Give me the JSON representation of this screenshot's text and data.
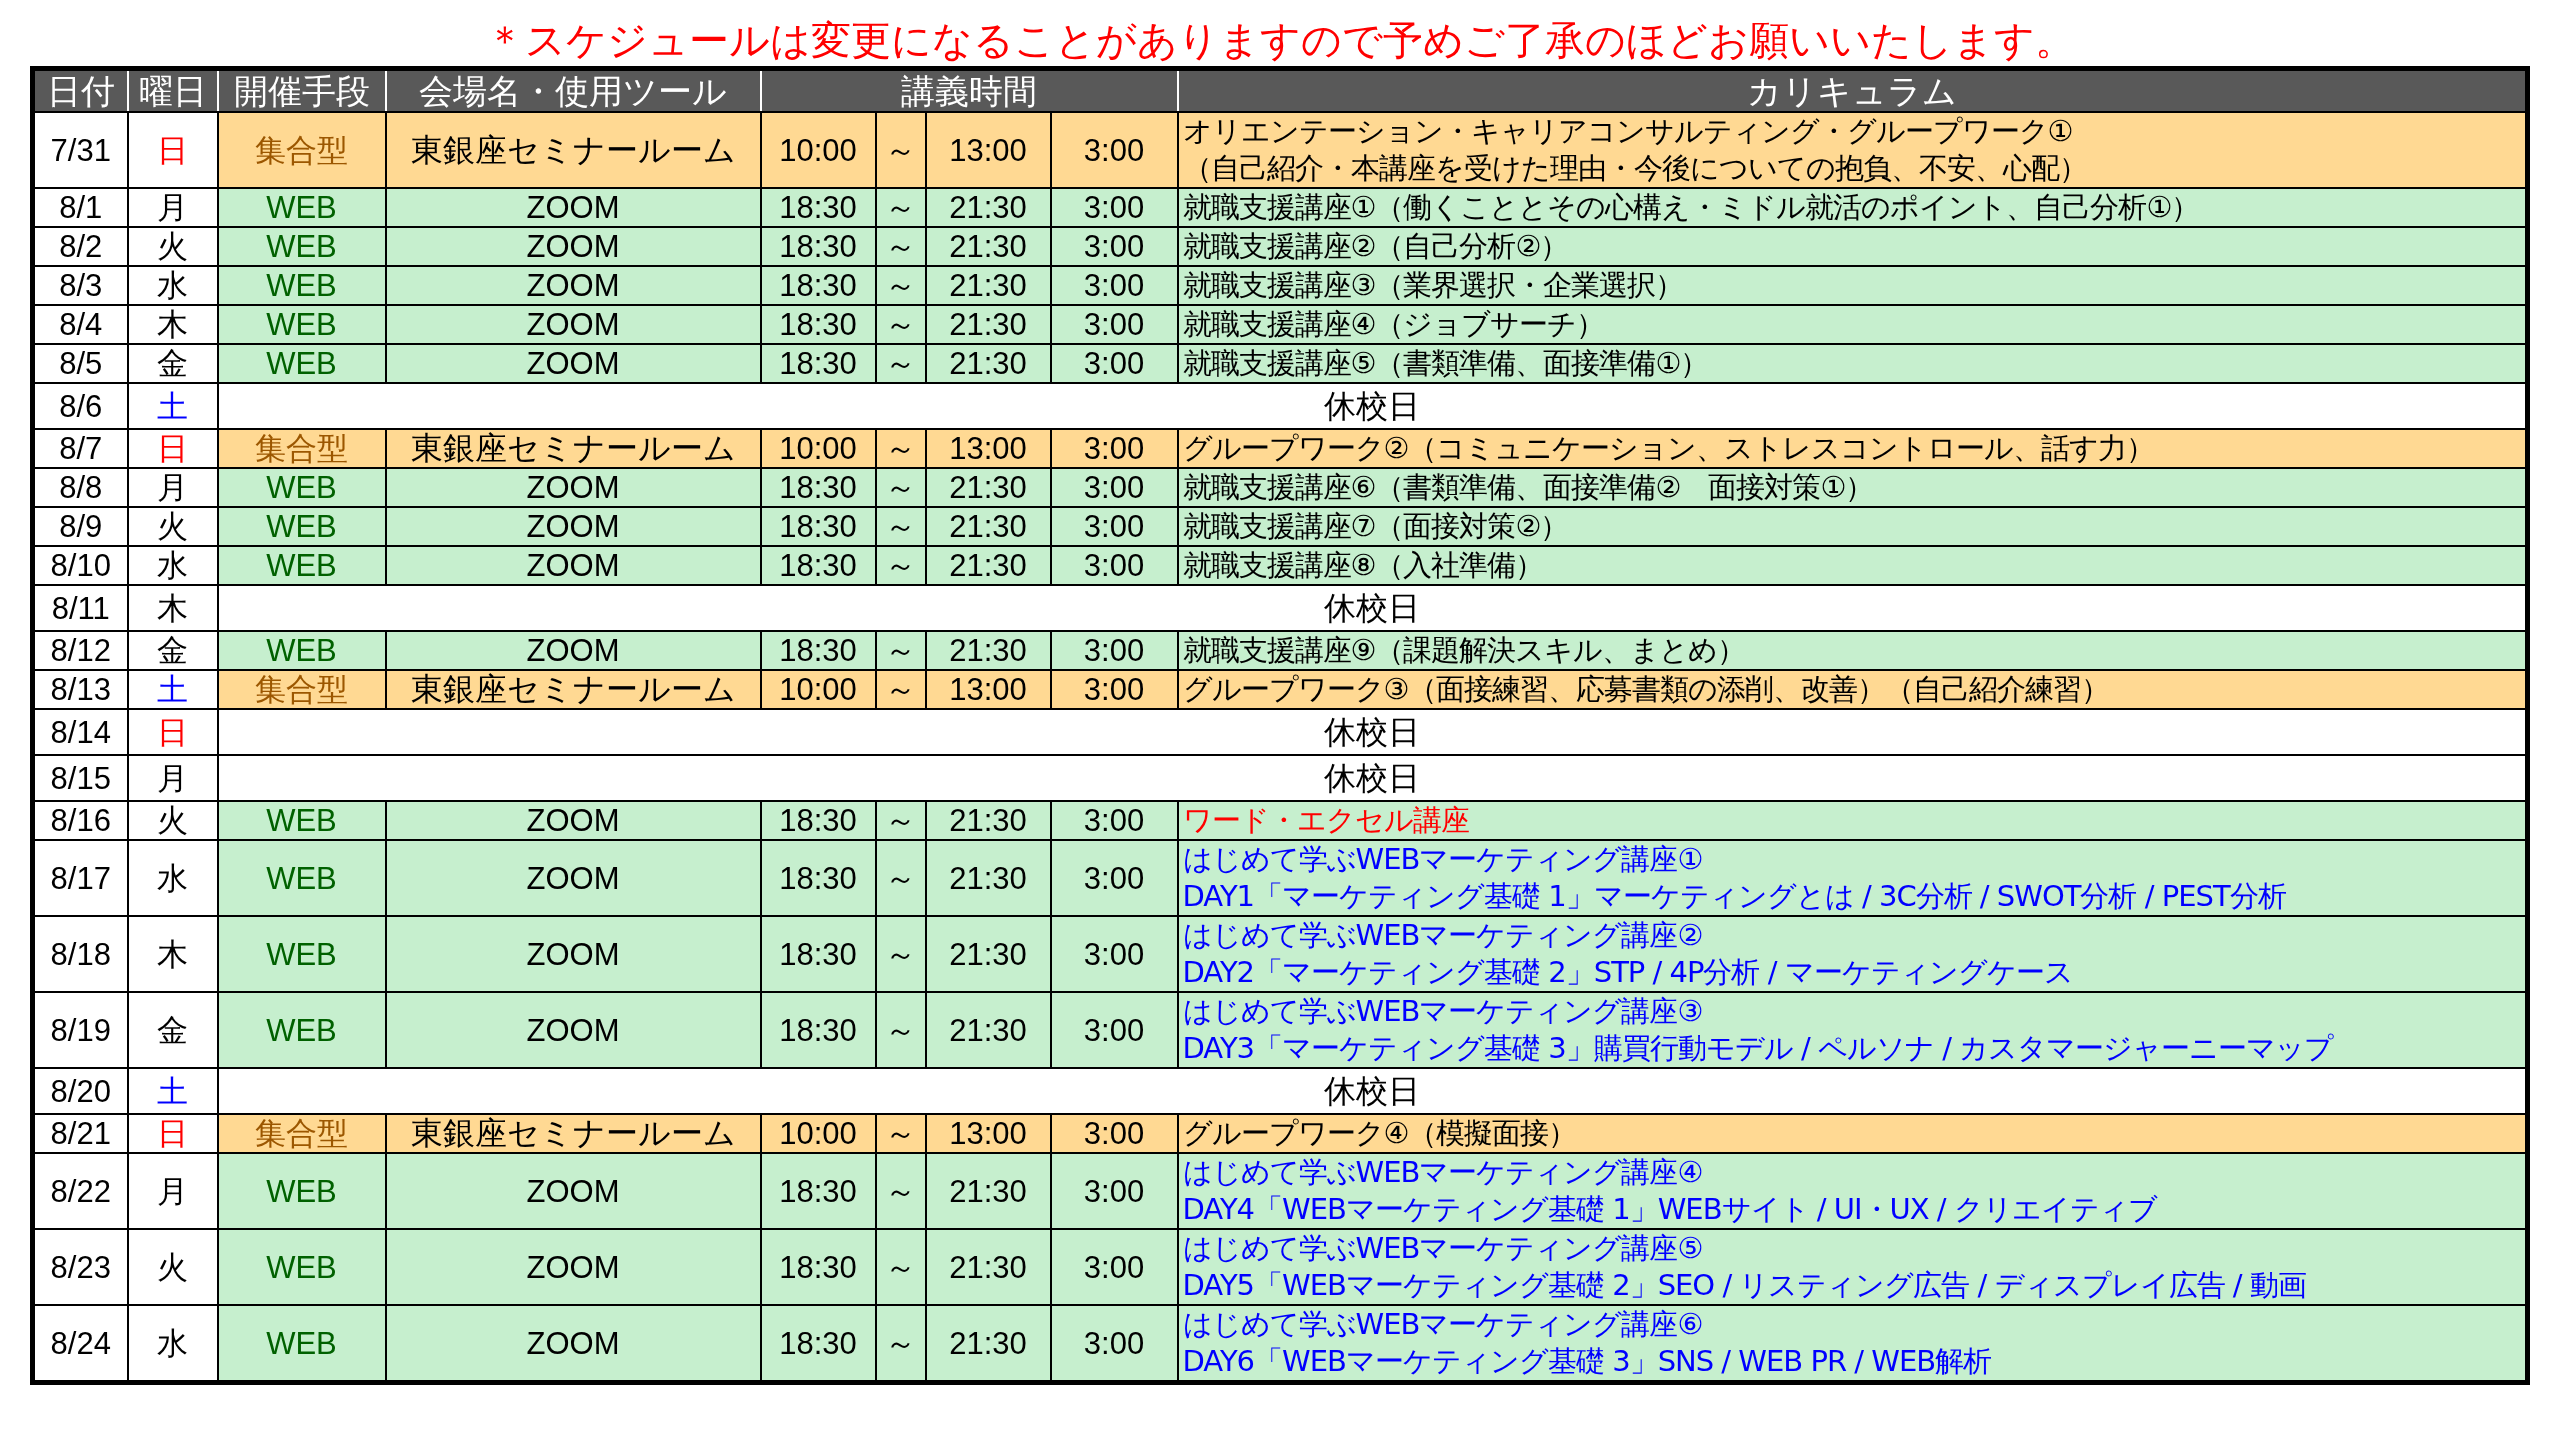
{
  "notice": "＊スケジュールは変更になることがありますので予めご了承のほどお願いいたします。",
  "table": {
    "columns": [
      "日付",
      "曜日",
      "開催手段",
      "会場名・使用ツール",
      "講義時間",
      "カリキュラム"
    ],
    "rows": [
      {
        "kind": "venue",
        "date": "7/31",
        "day": {
          "text": "日",
          "color": "#ff0000"
        },
        "method": "集合型",
        "place": "東銀座セミナールーム",
        "start": "10:00",
        "tilde": "～",
        "end": "13:00",
        "duration": "3:00",
        "curriculum": {
          "lines": [
            "オリエンテーション・キャリアコンサルティング・グループワーク①",
            "（自己紹介・本講座を受けた理由・今後についての抱負、不安、心配）"
          ],
          "color": "#000000"
        }
      },
      {
        "kind": "web",
        "date": "8/1",
        "day": {
          "text": "月",
          "color": "#000000"
        },
        "method": "WEB",
        "place": "ZOOM",
        "start": "18:30",
        "tilde": "～",
        "end": "21:30",
        "duration": "3:00",
        "curriculum": {
          "lines": [
            "就職支援講座①（働くこととその心構え・ミドル就活のポイント、自己分析①）"
          ],
          "color": "#000000"
        }
      },
      {
        "kind": "web",
        "date": "8/2",
        "day": {
          "text": "火",
          "color": "#000000"
        },
        "method": "WEB",
        "place": "ZOOM",
        "start": "18:30",
        "tilde": "～",
        "end": "21:30",
        "duration": "3:00",
        "curriculum": {
          "lines": [
            "就職支援講座②（自己分析②）"
          ],
          "color": "#000000"
        }
      },
      {
        "kind": "web",
        "date": "8/3",
        "day": {
          "text": "水",
          "color": "#000000"
        },
        "method": "WEB",
        "place": "ZOOM",
        "start": "18:30",
        "tilde": "～",
        "end": "21:30",
        "duration": "3:00",
        "curriculum": {
          "lines": [
            "就職支援講座③（業界選択・企業選択）"
          ],
          "color": "#000000"
        }
      },
      {
        "kind": "web",
        "date": "8/4",
        "day": {
          "text": "木",
          "color": "#000000"
        },
        "method": "WEB",
        "place": "ZOOM",
        "start": "18:30",
        "tilde": "～",
        "end": "21:30",
        "duration": "3:00",
        "curriculum": {
          "lines": [
            "就職支援講座④（ジョブサーチ）"
          ],
          "color": "#000000"
        }
      },
      {
        "kind": "web",
        "date": "8/5",
        "day": {
          "text": "金",
          "color": "#000000"
        },
        "method": "WEB",
        "place": "ZOOM",
        "start": "18:30",
        "tilde": "～",
        "end": "21:30",
        "duration": "3:00",
        "curriculum": {
          "lines": [
            "就職支援講座⑤（書類準備、面接準備①）"
          ],
          "color": "#000000"
        }
      },
      {
        "kind": "holiday",
        "date": "8/6",
        "day": {
          "text": "土",
          "color": "#0000ff"
        },
        "note": "休校日"
      },
      {
        "kind": "venue",
        "date": "8/7",
        "day": {
          "text": "日",
          "color": "#ff0000"
        },
        "method": "集合型",
        "place": "東銀座セミナールーム",
        "start": "10:00",
        "tilde": "～",
        "end": "13:00",
        "duration": "3:00",
        "curriculum": {
          "lines": [
            "グループワーク②（コミュニケーション、ストレスコントロール、話す力）"
          ],
          "color": "#000000"
        }
      },
      {
        "kind": "web",
        "date": "8/8",
        "day": {
          "text": "月",
          "color": "#000000"
        },
        "method": "WEB",
        "place": "ZOOM",
        "start": "18:30",
        "tilde": "～",
        "end": "21:30",
        "duration": "3:00",
        "curriculum": {
          "lines": [
            "就職支援講座⑥（書類準備、面接準備②　面接対策①）"
          ],
          "color": "#000000"
        }
      },
      {
        "kind": "web",
        "date": "8/9",
        "day": {
          "text": "火",
          "color": "#000000"
        },
        "method": "WEB",
        "place": "ZOOM",
        "start": "18:30",
        "tilde": "～",
        "end": "21:30",
        "duration": "3:00",
        "curriculum": {
          "lines": [
            "就職支援講座⑦（面接対策②）"
          ],
          "color": "#000000"
        }
      },
      {
        "kind": "web",
        "date": "8/10",
        "day": {
          "text": "水",
          "color": "#000000"
        },
        "method": "WEB",
        "place": "ZOOM",
        "start": "18:30",
        "tilde": "～",
        "end": "21:30",
        "duration": "3:00",
        "curriculum": {
          "lines": [
            "就職支援講座⑧（入社準備）"
          ],
          "color": "#000000"
        }
      },
      {
        "kind": "holiday",
        "date": "8/11",
        "day": {
          "text": "木",
          "color": "#000000"
        },
        "note": "休校日"
      },
      {
        "kind": "web",
        "date": "8/12",
        "day": {
          "text": "金",
          "color": "#000000"
        },
        "method": "WEB",
        "place": "ZOOM",
        "start": "18:30",
        "tilde": "～",
        "end": "21:30",
        "duration": "3:00",
        "curriculum": {
          "lines": [
            "就職支援講座⑨（課題解決スキル、まとめ）"
          ],
          "color": "#000000"
        }
      },
      {
        "kind": "venue",
        "date": "8/13",
        "day": {
          "text": "土",
          "color": "#0000ff"
        },
        "method": "集合型",
        "place": "東銀座セミナールーム",
        "start": "10:00",
        "tilde": "～",
        "end": "13:00",
        "duration": "3:00",
        "curriculum": {
          "lines": [
            "グループワーク③（面接練習、応募書類の添削、改善）（自己紹介練習）"
          ],
          "color": "#000000"
        }
      },
      {
        "kind": "holiday",
        "date": "8/14",
        "day": {
          "text": "日",
          "color": "#ff0000"
        },
        "note": "休校日"
      },
      {
        "kind": "holiday",
        "date": "8/15",
        "day": {
          "text": "月",
          "color": "#000000"
        },
        "note": "休校日"
      },
      {
        "kind": "web",
        "date": "8/16",
        "day": {
          "text": "火",
          "color": "#000000"
        },
        "method": "WEB",
        "place": "ZOOM",
        "start": "18:30",
        "tilde": "～",
        "end": "21:30",
        "duration": "3:00",
        "curriculum": {
          "lines": [
            "ワード・エクセル講座"
          ],
          "color": "#ff0000"
        }
      },
      {
        "kind": "web",
        "date": "8/17",
        "day": {
          "text": "水",
          "color": "#000000"
        },
        "method": "WEB",
        "place": "ZOOM",
        "start": "18:30",
        "tilde": "～",
        "end": "21:30",
        "duration": "3:00",
        "curriculum": {
          "lines": [
            "はじめて学ぶWEBマーケティング講座①",
            "DAY1「マーケティング基礎 1」マーケティングとは / 3C分析 / SWOT分析 / PEST分析"
          ],
          "color": "#0000ff"
        }
      },
      {
        "kind": "web",
        "date": "8/18",
        "day": {
          "text": "木",
          "color": "#000000"
        },
        "method": "WEB",
        "place": "ZOOM",
        "start": "18:30",
        "tilde": "～",
        "end": "21:30",
        "duration": "3:00",
        "curriculum": {
          "lines": [
            "はじめて学ぶWEBマーケティング講座②",
            "DAY2「マーケティング基礎 2」STP / 4P分析 / マーケティングケース"
          ],
          "color": "#0000ff"
        }
      },
      {
        "kind": "web",
        "date": "8/19",
        "day": {
          "text": "金",
          "color": "#000000"
        },
        "method": "WEB",
        "place": "ZOOM",
        "start": "18:30",
        "tilde": "～",
        "end": "21:30",
        "duration": "3:00",
        "curriculum": {
          "lines": [
            "はじめて学ぶWEBマーケティング講座③",
            "DAY3「マーケティング基礎 3」購買行動モデル / ペルソナ / カスタマージャーニーマップ"
          ],
          "color": "#0000ff"
        }
      },
      {
        "kind": "holiday",
        "date": "8/20",
        "day": {
          "text": "土",
          "color": "#0000ff"
        },
        "note": "休校日"
      },
      {
        "kind": "venue",
        "date": "8/21",
        "day": {
          "text": "日",
          "color": "#ff0000"
        },
        "method": "集合型",
        "place": "東銀座セミナールーム",
        "start": "10:00",
        "tilde": "～",
        "end": "13:00",
        "duration": "3:00",
        "curriculum": {
          "lines": [
            "グループワーク④（模擬面接）"
          ],
          "color": "#000000"
        }
      },
      {
        "kind": "web",
        "date": "8/22",
        "day": {
          "text": "月",
          "color": "#000000"
        },
        "method": "WEB",
        "place": "ZOOM",
        "start": "18:30",
        "tilde": "～",
        "end": "21:30",
        "duration": "3:00",
        "curriculum": {
          "lines": [
            "はじめて学ぶWEBマーケティング講座④",
            "DAY4「WEBマーケティング基礎 1」WEBサイト / UI・UX / クリエイティブ"
          ],
          "color": "#0000ff"
        }
      },
      {
        "kind": "web",
        "date": "8/23",
        "day": {
          "text": "火",
          "color": "#000000"
        },
        "method": "WEB",
        "place": "ZOOM",
        "start": "18:30",
        "tilde": "～",
        "end": "21:30",
        "duration": "3:00",
        "curriculum": {
          "lines": [
            "はじめて学ぶWEBマーケティング講座⑤",
            "DAY5「WEBマーケティング基礎 2」SEO / リスティング広告 / ディスプレイ広告 / 動画"
          ],
          "color": "#0000ff"
        }
      },
      {
        "kind": "web",
        "date": "8/24",
        "day": {
          "text": "水",
          "color": "#000000"
        },
        "method": "WEB",
        "place": "ZOOM",
        "start": "18:30",
        "tilde": "～",
        "end": "21:30",
        "duration": "3:00",
        "curriculum": {
          "lines": [
            "はじめて学ぶWEBマーケティング講座⑥",
            "DAY6「WEBマーケティング基礎 3」SNS / WEB PR / WEB解析"
          ],
          "color": "#0000ff"
        }
      }
    ]
  }
}
